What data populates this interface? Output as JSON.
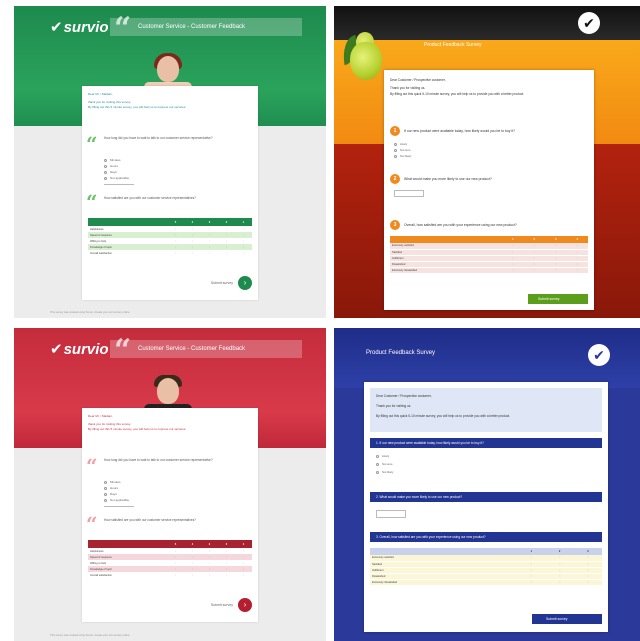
{
  "green": {
    "logo": "survio",
    "header_title": "Customer Service - Customer Feedback",
    "greeting": "Dear Mr. / Madam,",
    "thanks": "thank you for visiting this survey.",
    "intro": "By filling out this 5 minute survey, you will help us to improve our services.",
    "q1": "How long did you have to wait to talk to our customer service representative?",
    "q1_options": [
      "Minutes",
      "Hours",
      "Days",
      "Not applicable"
    ],
    "q2": "How satisfied are you with our customer service representatives?",
    "table_header": [
      "",
      "5",
      "4",
      "3",
      "2",
      "1"
    ],
    "table_rows": [
      "Helpfulness",
      "Speed of response",
      "Willing to help",
      "Knowledge of topic",
      "Overall satisfaction"
    ],
    "submit": "Submit survey",
    "footer": "This survey was created using Survio. Create your own survey online."
  },
  "orange": {
    "title": "Product Feedback Survey",
    "greeting": "Dear Customer / Prospective customer,",
    "thanks": "Thank you for visiting us.",
    "intro": "By filling out this quick 5-10 minute survey, you will help us to provide you with a better product.",
    "q1": "If our new product were available today, how likely would you be to buy it?",
    "q1_options": [
      "Likely",
      "Not sure",
      "Not likely"
    ],
    "q2": "What would make you more likely to use our new product?",
    "q3": "Overall, how satisfied are you with your experience using our new product?",
    "table_header": [
      "",
      "1",
      "2",
      "3",
      "4"
    ],
    "table_rows": [
      "Extremely satisfied",
      "Satisfied",
      "Indifferent",
      "Dissatisfied",
      "Extremely dissatisfied"
    ],
    "submit": "Submit survey"
  },
  "red": {
    "logo": "survio",
    "header_title": "Customer Service - Customer Feedback",
    "greeting": "Dear Mr. / Madam,",
    "thanks": "thank you for visiting this survey.",
    "intro": "By filling out this 5 minute survey, you will help us to improve our services.",
    "q1": "How long did you have to wait to talk to our customer service representative?",
    "q1_options": [
      "Minutes",
      "Hours",
      "Days",
      "Not applicable"
    ],
    "q2": "How satisfied are you with our customer service representatives?",
    "table_header": [
      "",
      "5",
      "4",
      "3",
      "2",
      "1"
    ],
    "table_rows": [
      "Helpfulness",
      "Speed of response",
      "Willing to help",
      "Knowledge of topic",
      "Overall satisfaction"
    ],
    "submit": "Submit survey",
    "footer": "This survey was created using Survio. Create your own survey online."
  },
  "blue": {
    "title": "Product Feedback Survey",
    "greeting": "Dear Customer / Prospective customer,",
    "thanks": "Thank you for visiting us.",
    "intro": "By filling out this quick 5-10 minute survey, you will help us to provide you with a better product.",
    "q1": "1. If our new product were available today, how likely would you be to buy it?",
    "q1_options": [
      "Likely",
      "Not sure",
      "Not likely"
    ],
    "q2": "2. What would make you more likely to use our new product?",
    "q3": "3. Overall, how satisfied are you with your experience using our new product?",
    "table_header": [
      "",
      "1",
      "2",
      "3"
    ],
    "table_rows": [
      "Extremely satisfied",
      "Satisfied",
      "Indifferent",
      "Dissatisfied",
      "Extremely dissatisfied"
    ],
    "submit": "Submit survey"
  },
  "colors": {
    "green": "#1e8a4e",
    "orange": "#f08a1e",
    "red": "#c42c3c",
    "blue": "#233592"
  }
}
